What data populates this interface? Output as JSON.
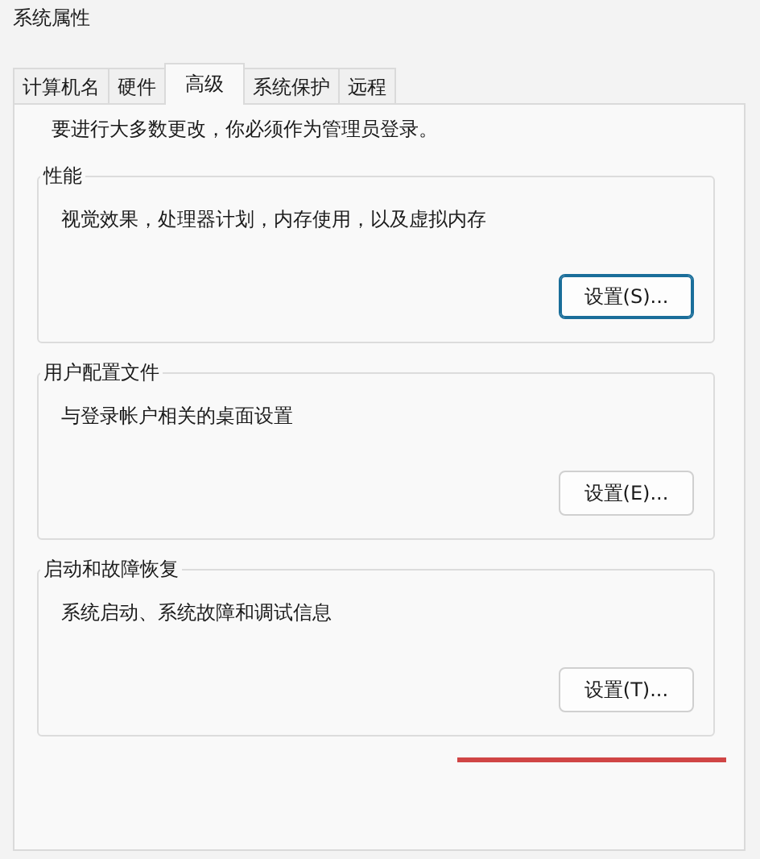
{
  "window": {
    "title": "系统属性"
  },
  "tabs": [
    {
      "label": "计算机名",
      "selected": false
    },
    {
      "label": "硬件",
      "selected": false
    },
    {
      "label": "高级",
      "selected": true
    },
    {
      "label": "系统保护",
      "selected": false
    },
    {
      "label": "远程",
      "selected": false
    }
  ],
  "notice": "要进行大多数更改，你必须作为管理员登录。",
  "groups": [
    {
      "title": "性能",
      "description": "视觉效果，处理器计划，内存使用，以及虚拟内存",
      "button": "设置(S)...",
      "focused": true
    },
    {
      "title": "用户配置文件",
      "description": "与登录帐户相关的桌面设置",
      "button": "设置(E)...",
      "focused": false
    },
    {
      "title": "启动和故障恢复",
      "description": "系统启动、系统故障和调试信息",
      "button": "设置(T)...",
      "focused": false
    }
  ]
}
